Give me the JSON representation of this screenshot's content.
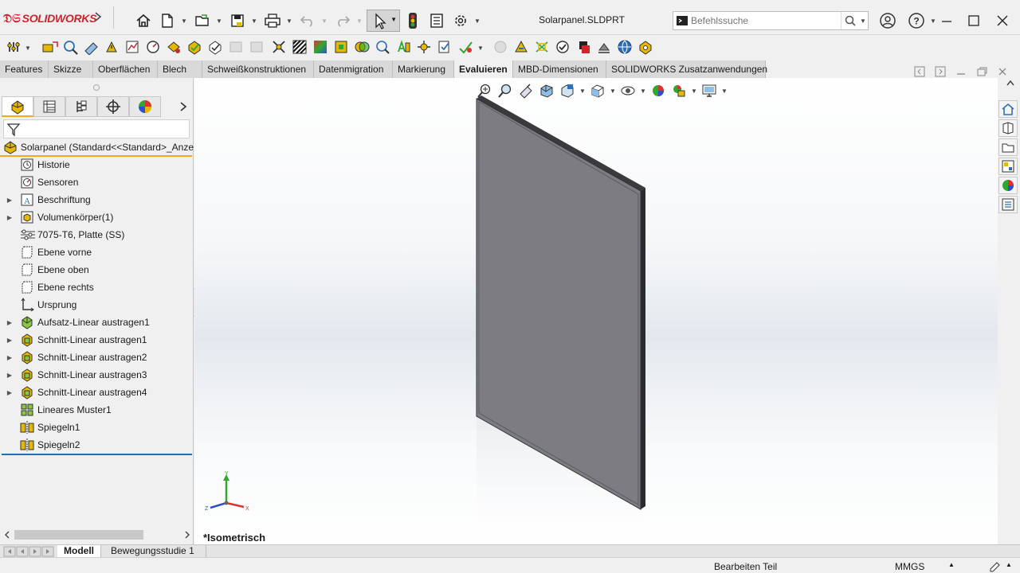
{
  "app": {
    "brand": "SOLIDWORKS",
    "file_title": "Solarpanel.SLDPRT",
    "colors": {
      "brand_red": "#d2232a",
      "accent_orange": "#f5a623",
      "selection_blue": "#1f6fb5",
      "panel_gray": "#7d7c82"
    }
  },
  "search": {
    "placeholder": "Befehlssuche"
  },
  "command_tabs": [
    {
      "label": "Features"
    },
    {
      "label": "Skizze"
    },
    {
      "label": "Oberflächen"
    },
    {
      "label": "Blech"
    },
    {
      "label": "Schweißkonstruktionen"
    },
    {
      "label": "Datenmigration"
    },
    {
      "label": "Markierung"
    },
    {
      "label": "Evaluieren",
      "active": true
    },
    {
      "label": "MBD-Dimensionen"
    },
    {
      "label": "SOLIDWORKS Zusatzanwendungen"
    }
  ],
  "feature_tree": {
    "root": "Solarpanel  (Standard<<Standard>_Anze",
    "items": [
      {
        "label": "Historie",
        "icon": "history-icon",
        "expandable": false
      },
      {
        "label": "Sensoren",
        "icon": "sensor-icon",
        "expandable": false
      },
      {
        "label": "Beschriftung",
        "icon": "annotation-icon",
        "expandable": true
      },
      {
        "label": "Volumenkörper(1)",
        "icon": "solid-bodies-icon",
        "expandable": true
      },
      {
        "label": "7075-T6, Platte (SS)",
        "icon": "material-icon",
        "expandable": false
      },
      {
        "label": "Ebene vorne",
        "icon": "plane-icon",
        "expandable": false
      },
      {
        "label": "Ebene oben",
        "icon": "plane-icon",
        "expandable": false
      },
      {
        "label": "Ebene rechts",
        "icon": "plane-icon",
        "expandable": false
      },
      {
        "label": "Ursprung",
        "icon": "origin-icon",
        "expandable": false
      },
      {
        "label": "Aufsatz-Linear austragen1",
        "icon": "boss-extrude-icon",
        "expandable": true
      },
      {
        "label": "Schnitt-Linear austragen1",
        "icon": "cut-extrude-icon",
        "expandable": true
      },
      {
        "label": "Schnitt-Linear austragen2",
        "icon": "cut-extrude-icon",
        "expandable": true
      },
      {
        "label": "Schnitt-Linear austragen3",
        "icon": "cut-extrude-icon",
        "expandable": true
      },
      {
        "label": "Schnitt-Linear austragen4",
        "icon": "cut-extrude-icon",
        "expandable": true
      },
      {
        "label": "Lineares Muster1",
        "icon": "linear-pattern-icon",
        "expandable": false
      },
      {
        "label": "Spiegeln1",
        "icon": "mirror-icon",
        "expandable": false
      },
      {
        "label": "Spiegeln2",
        "icon": "mirror-icon",
        "expandable": false
      }
    ]
  },
  "viewport": {
    "view_label": "*Isometrisch",
    "triad": {
      "x": "X",
      "y": "Y",
      "z": "Z"
    }
  },
  "bottom_tabs": [
    {
      "label": "Modell",
      "active": true
    },
    {
      "label": "Bewegungsstudie 1"
    }
  ],
  "status": {
    "message": "Bearbeiten Teil",
    "units": "MMGS"
  }
}
